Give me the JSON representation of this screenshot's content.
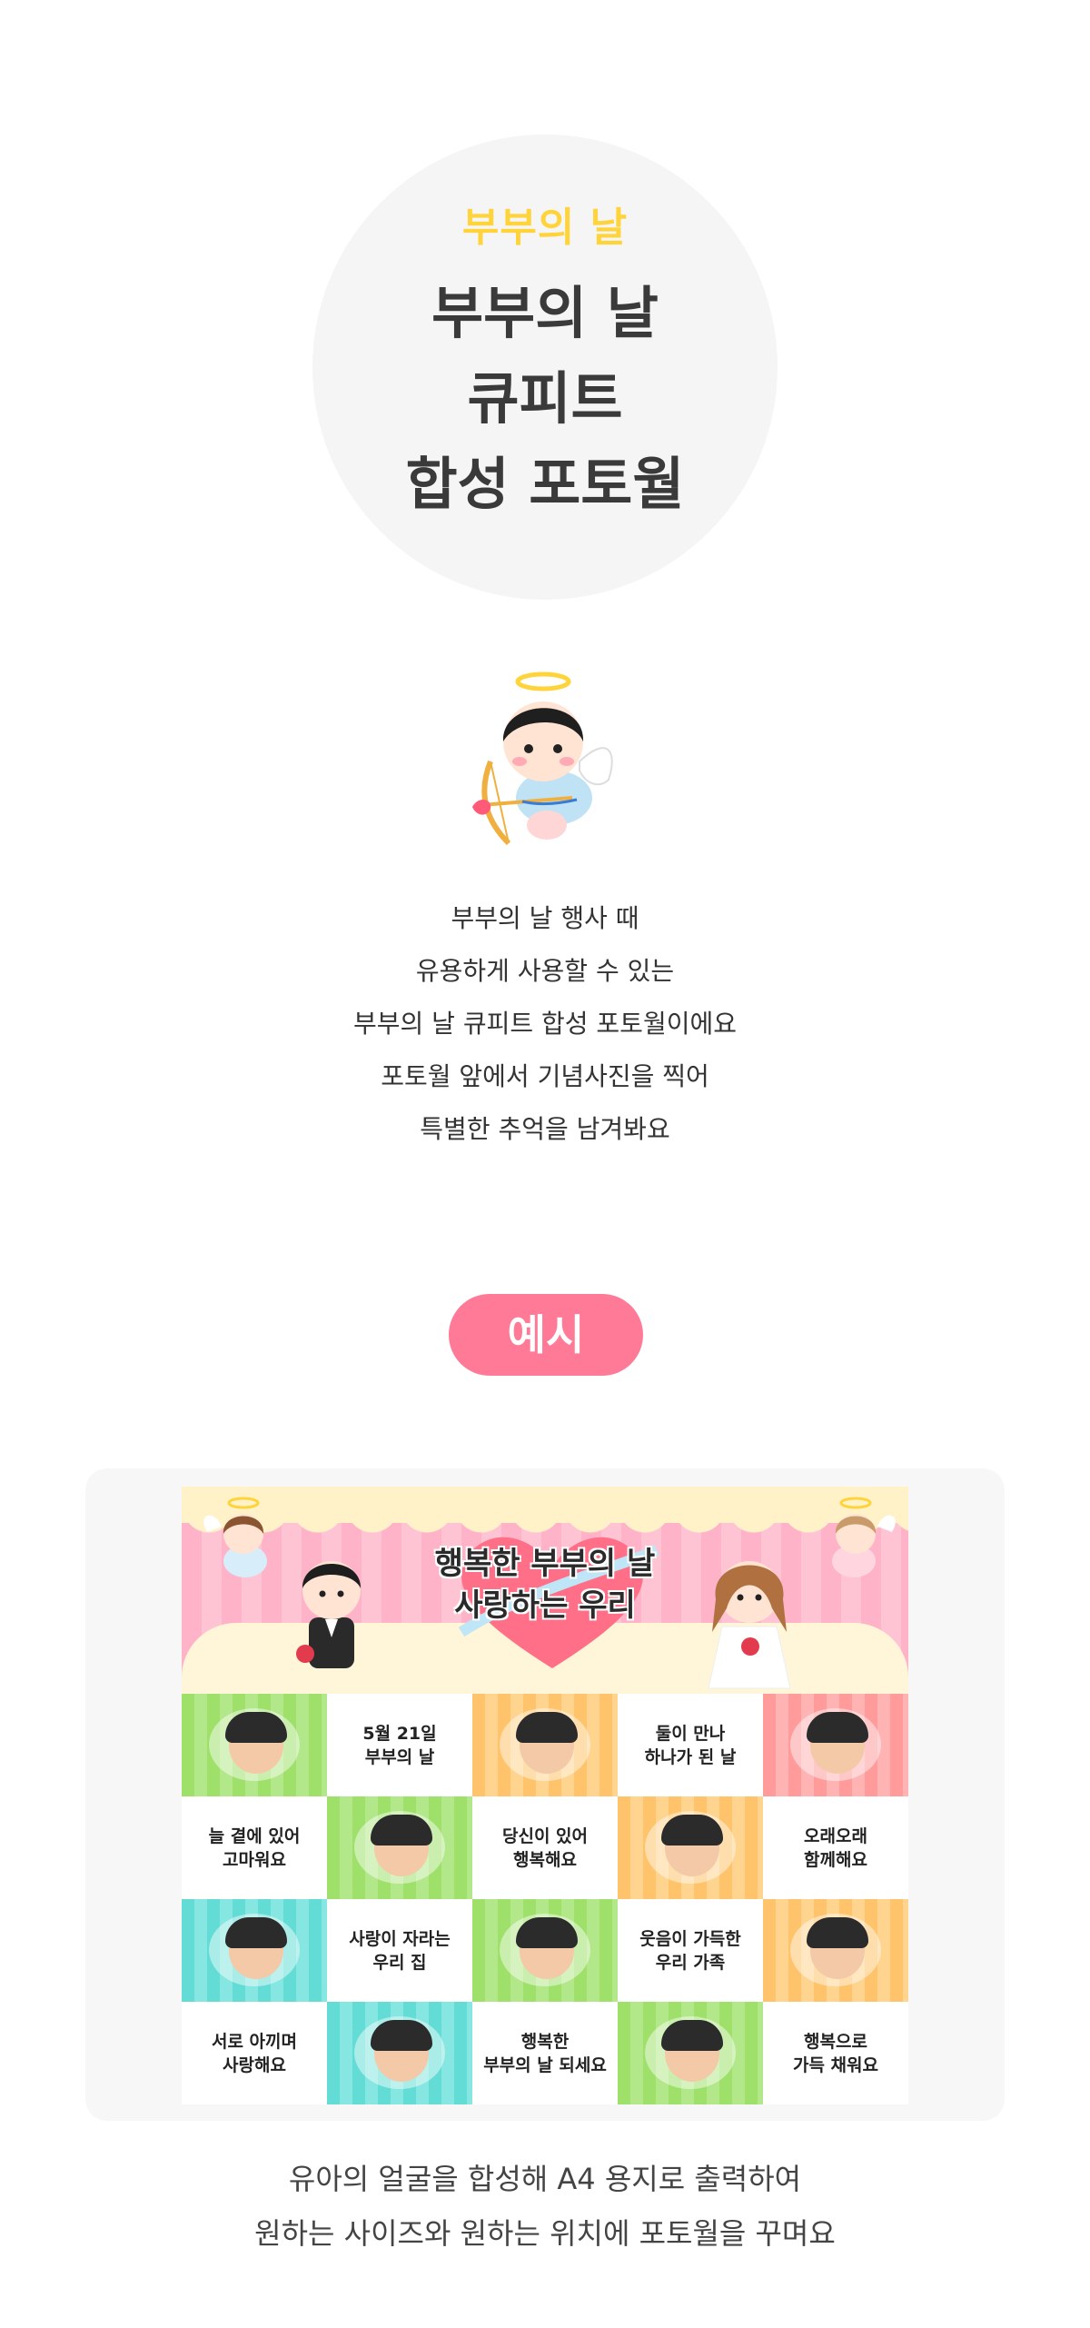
{
  "hero": {
    "subtitle": "부부의 날",
    "title_lines": [
      "부부의 날",
      "큐피트",
      "합성 포토월"
    ]
  },
  "intro": {
    "lines": [
      "부부의 날 행사 때",
      "유용하게 사용할 수 있는",
      "부부의 날 큐피트 합성 포토월이에요",
      "포토월 앞에서 기념사진을 찍어",
      "특별한 추억을 남겨봐요"
    ]
  },
  "example": {
    "label": "예시",
    "poster": {
      "title_lines": [
        "행복한 부부의 날",
        "사랑하는 우리"
      ],
      "cells": [
        {
          "type": "photo",
          "color": "green"
        },
        {
          "type": "text",
          "lines": [
            "5월 21일",
            "부부의 날"
          ]
        },
        {
          "type": "photo",
          "color": "orange"
        },
        {
          "type": "text",
          "lines": [
            "둘이 만나",
            "하나가 된 날"
          ]
        },
        {
          "type": "photo",
          "color": "pink"
        },
        {
          "type": "text",
          "lines": [
            "늘 곁에 있어",
            "고마워요"
          ]
        },
        {
          "type": "photo",
          "color": "green"
        },
        {
          "type": "text",
          "lines": [
            "당신이 있어",
            "행복해요"
          ]
        },
        {
          "type": "photo",
          "color": "orange"
        },
        {
          "type": "text",
          "lines": [
            "오래오래",
            "함께해요"
          ]
        },
        {
          "type": "photo",
          "color": "teal"
        },
        {
          "type": "text",
          "lines": [
            "사랑이 자라는",
            "우리 집"
          ]
        },
        {
          "type": "photo",
          "color": "green"
        },
        {
          "type": "text",
          "lines": [
            "웃음이 가득한",
            "우리 가족"
          ]
        },
        {
          "type": "photo",
          "color": "orange"
        },
        {
          "type": "text",
          "lines": [
            "서로 아끼며",
            "사랑해요"
          ]
        },
        {
          "type": "photo",
          "color": "teal"
        },
        {
          "type": "text",
          "lines": [
            "행복한",
            "부부의 날 되세요"
          ]
        },
        {
          "type": "photo",
          "color": "green"
        },
        {
          "type": "text",
          "lines": [
            "행복으로",
            "가득 채워요"
          ]
        }
      ]
    }
  },
  "footer": {
    "lines": [
      "유아의 얼굴을 합성해 A4 용지로 출력하여",
      "원하는 사이즈와 원하는 위치에 포토월을 꾸며요"
    ]
  },
  "colors": {
    "accent_pink": "#ff7a96",
    "accent_yellow": "#ffd43b",
    "circle_bg": "#f5f5f5",
    "card_bg": "#f7f7f7"
  }
}
